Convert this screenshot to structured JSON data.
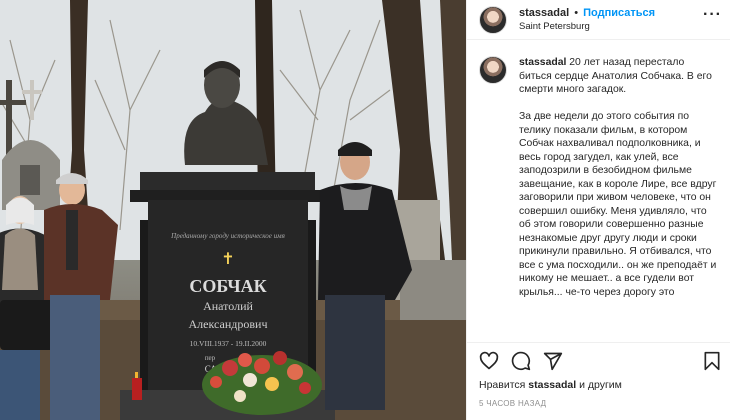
{
  "post": {
    "photo_alt": "",
    "header": {
      "username": "stassadal",
      "dot": "•",
      "follow": "Подписаться",
      "location": "Saint Petersburg",
      "more": "···"
    },
    "caption": {
      "username": "stassadal",
      "p1": "20 лет назад перестало биться сердце Анатолия Собчака. В его смерти много загадок.",
      "p2": "За две недели до этого события по телику показали фильм, в котором Собчак нахваливал подполковника, и весь город загудел, как улей, все заподозрили в безобидном фильме завещание, как в короле Лире, все вдруг заговорили при живом человеке, что он совершил ошибку. Меня удивляло, что об этом говорили совершенно разные незнакомые друг другу люди и сроки прикинули правильно. Я отбивался, что все с ума посходили.. он же преподаёт и никому не мешает.. а все гудели вот крылья... че-то через дорогу это"
    },
    "monument": {
      "dedication": "Преданному городу историческое имя",
      "name": "СОБЧАК",
      "first": "Анатолий",
      "patronymic": "Александрович",
      "dates": "10.VIII.1937 - 19.II.2000",
      "extra1": "пер",
      "extra2": "САН"
    },
    "likes": {
      "prefix": "Нравится",
      "user": "stassadal",
      "suffix": "и другим"
    },
    "time": "5 ЧАСОВ НАЗАД",
    "colors": {
      "follow": "#0095f6",
      "text": "#262626",
      "muted": "#8e8e8e"
    },
    "icons": [
      "heart-icon",
      "comment-icon",
      "share-icon",
      "bookmark-icon"
    ]
  }
}
